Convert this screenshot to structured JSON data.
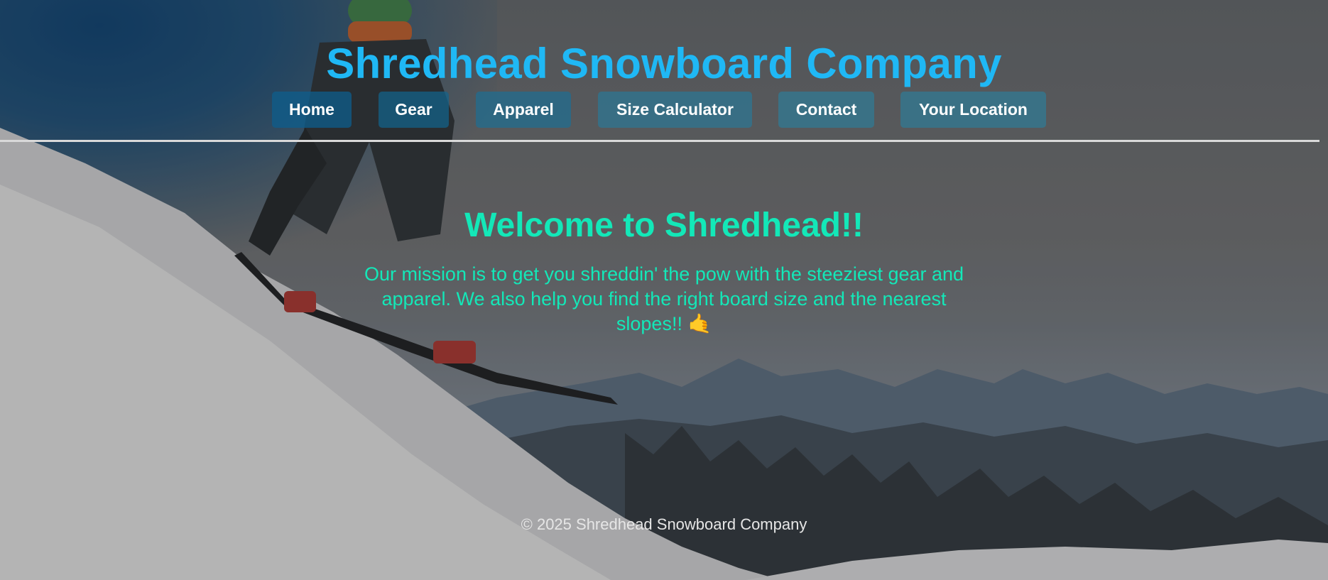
{
  "header": {
    "title": "Shredhead Snowboard Company"
  },
  "nav": {
    "items": [
      {
        "label": "Home"
      },
      {
        "label": "Gear"
      },
      {
        "label": "Apparel"
      },
      {
        "label": "Size Calculator"
      },
      {
        "label": "Contact"
      },
      {
        "label": "Your Location"
      }
    ]
  },
  "main": {
    "heading": "Welcome to Shredhead!!",
    "mission": "Our mission is to get you shreddin' the pow with the steeziest gear and apparel. We also help you find the right board size and the nearest slopes!!",
    "emoji": "🤙"
  },
  "footer": {
    "copyright": "© 2025 Shredhead Snowboard Company"
  },
  "colors": {
    "title": "#1fb8f5",
    "accent_text": "#13e8b8",
    "nav_button": "#2d7691",
    "divider": "#d9d9d9"
  },
  "icons": {
    "mission_emoji": "call-me-hand-icon"
  }
}
